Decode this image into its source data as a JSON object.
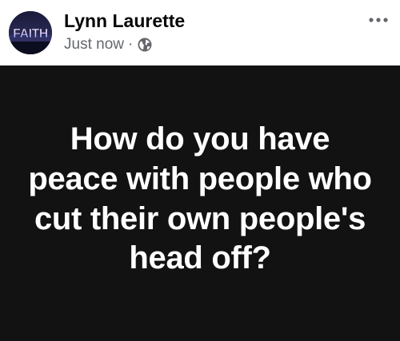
{
  "post": {
    "author": "Lynn Laurette",
    "avatar_text": "FAITH",
    "timestamp": "Just now",
    "separator": "·",
    "audience_icon": "globe-icon",
    "more_icon": "more-options-icon",
    "text": "How do you have peace with people who cut their own people's head off?"
  },
  "colors": {
    "author_name": "#050505",
    "meta_text": "#65676b",
    "post_background": "#121212",
    "post_text": "#ffffff"
  }
}
